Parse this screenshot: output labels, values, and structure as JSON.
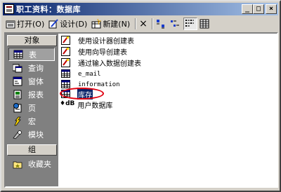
{
  "window": {
    "title": "职工资料：数据库",
    "buttons": [
      "_",
      "□",
      "×"
    ]
  },
  "toolbar": {
    "open_label": "打开(O)",
    "design_label": "设计(D)",
    "new_label": "新建(N)",
    "delete_symbol": "×",
    "view_icons": [
      "large-icons",
      "small-icons",
      "list",
      "details"
    ]
  },
  "sidebar": {
    "objects_header": "对象",
    "groups_header": "组",
    "items": [
      {
        "label": "表",
        "icon": "table-icon"
      },
      {
        "label": "查询",
        "icon": "query-icon"
      },
      {
        "label": "窗体",
        "icon": "form-icon"
      },
      {
        "label": "报表",
        "icon": "report-icon"
      },
      {
        "label": "页",
        "icon": "page-icon"
      },
      {
        "label": "宏",
        "icon": "macro-icon"
      },
      {
        "label": "模块",
        "icon": "module-icon"
      }
    ],
    "groups": [
      {
        "label": "收藏夹",
        "icon": "favorites-icon"
      }
    ]
  },
  "list": {
    "items": [
      {
        "label": "使用设计器创建表",
        "icon": "wizard-icon"
      },
      {
        "label": "使用向导创建表",
        "icon": "wizard-icon"
      },
      {
        "label": "通过输入数据创建表",
        "icon": "wizard-icon"
      },
      {
        "label": "e_mail",
        "icon": "table-icon"
      },
      {
        "label": "information",
        "icon": "table-icon"
      },
      {
        "label": "库存",
        "icon": "table-icon"
      },
      {
        "label": "用户数据库",
        "icon": "linked-db-icon",
        "prefix": "♦dB"
      }
    ]
  },
  "colors": {
    "title_gradient_start": "#08246b",
    "title_gradient_end": "#a5c2e8",
    "sidebar_bg": "#808080",
    "selection": "#0a246a",
    "highlight_circle": "#e00010"
  }
}
